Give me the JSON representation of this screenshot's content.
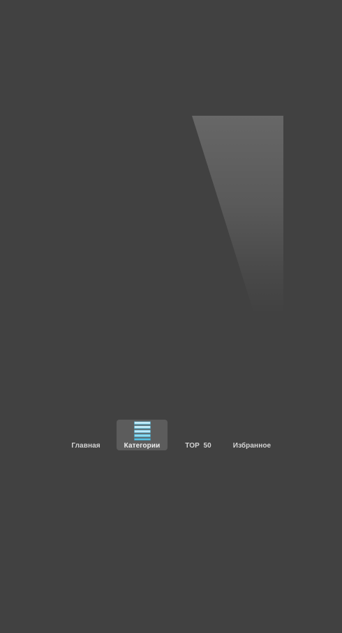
{
  "tabbar": {
    "tabs": [
      {
        "label": "Главная",
        "selected": false,
        "icon": "home-icon"
      },
      {
        "label": "Категории",
        "selected": true,
        "icon": "categories-list-icon"
      },
      {
        "label": "TOP  50",
        "selected": false,
        "icon": "top-icon"
      },
      {
        "label": "Избранное",
        "selected": false,
        "icon": "favorites-icon"
      }
    ]
  },
  "colors": {
    "background": "#414141",
    "selected_tab": "#5c5c5c",
    "icon_accent": "#5ec8ea"
  }
}
